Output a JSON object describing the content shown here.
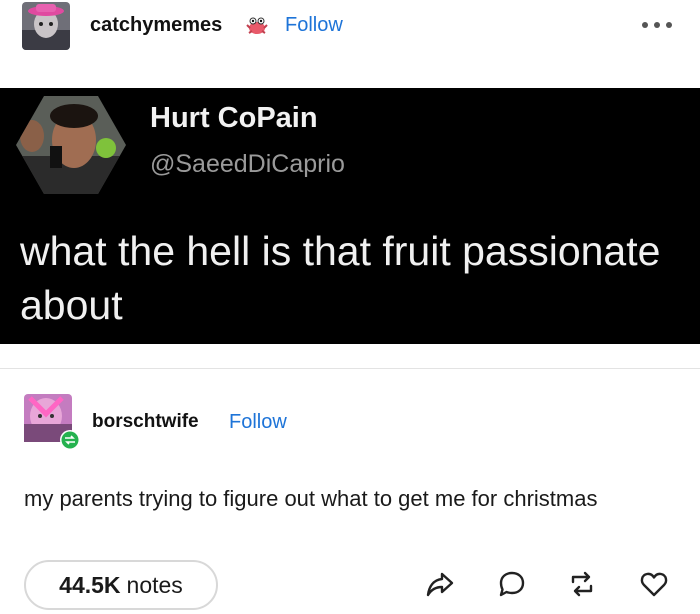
{
  "top_post": {
    "username": "catchymemes",
    "follow_label": "Follow",
    "badge_icon": "crab-badge-icon",
    "more_icon": "more-dots-icon"
  },
  "tweet": {
    "display_name": "Hurt CoPain",
    "handle": "@SaeedDiCaprio",
    "text": "what the hell is that fruit passionate about"
  },
  "reblog": {
    "username": "borschtwife",
    "follow_label": "Follow",
    "text": "my parents trying to figure out what to get me for christmas"
  },
  "footer": {
    "notes_count": "44.5K",
    "notes_label": "notes",
    "actions": [
      "share-icon",
      "comment-icon",
      "reblog-icon",
      "like-icon"
    ]
  },
  "colors": {
    "accent": "#1e74d8",
    "tweet_background": "#000000"
  }
}
